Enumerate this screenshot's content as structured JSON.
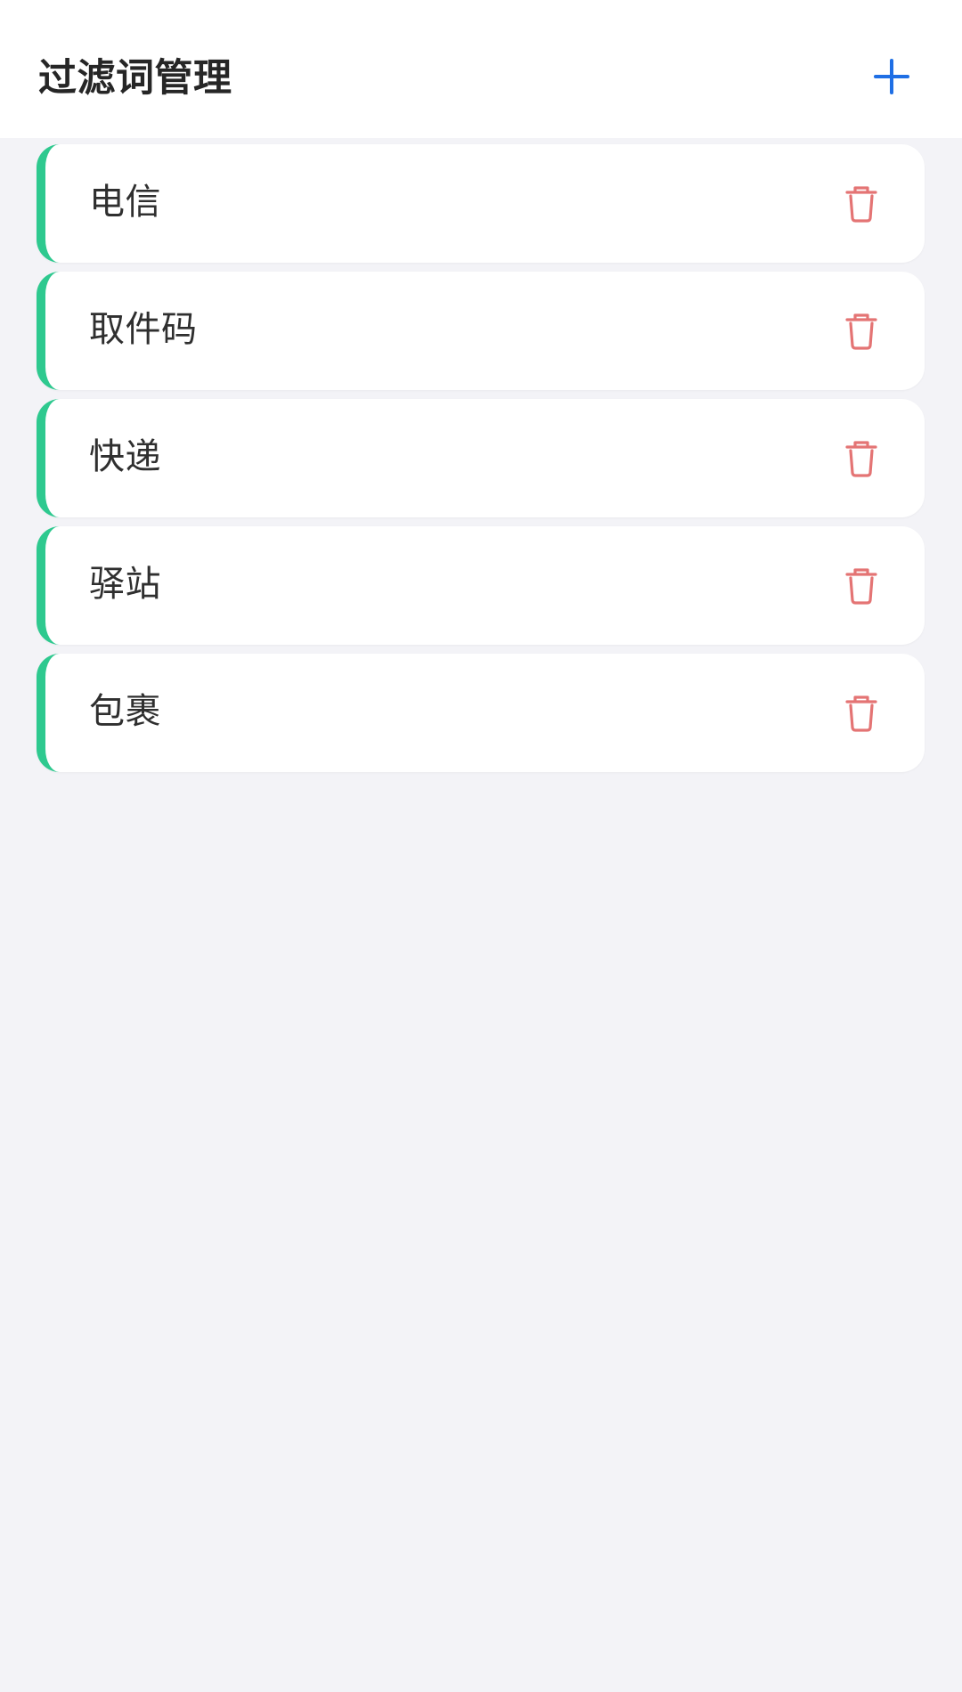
{
  "header": {
    "title": "过滤词管理",
    "add_icon": "plus-icon"
  },
  "colors": {
    "accent_green": "#2ec98f",
    "delete_red": "#e47474",
    "add_blue": "#1f6fe5",
    "background": "#f3f3f7",
    "card": "#ffffff"
  },
  "list": {
    "items": [
      {
        "label": "电信",
        "icon": "trash-icon"
      },
      {
        "label": "取件码",
        "icon": "trash-icon"
      },
      {
        "label": "快递",
        "icon": "trash-icon"
      },
      {
        "label": "驿站",
        "icon": "trash-icon"
      },
      {
        "label": "包裹",
        "icon": "trash-icon"
      }
    ]
  }
}
